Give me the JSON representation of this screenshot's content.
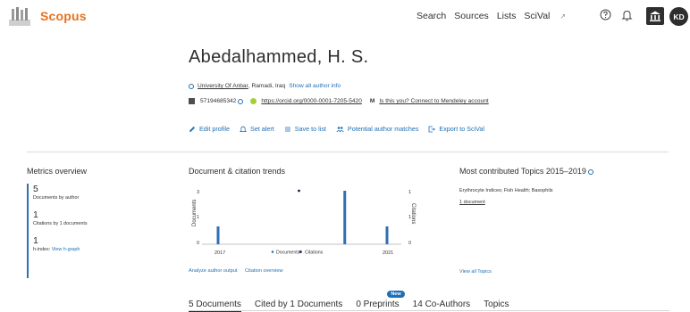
{
  "header": {
    "brand": "Scopus",
    "nav": [
      "Search",
      "Sources",
      "Lists",
      "SciVal"
    ],
    "nav_external_glyph": "↗",
    "avatar_initials": "KD",
    "icons": [
      "help-icon",
      "bell-icon",
      "institution-icon"
    ]
  },
  "author": {
    "name": "Abedalhammed, H. S.",
    "affiliation_link": "University Of Anbar",
    "affiliation_location": ", Ramadi, Iraq",
    "show_all_info": "Show all author info",
    "scopus_id": "57194685342",
    "orcid": "https://orcid.org/0000-0001-7205-5420",
    "mendeley_icon": "M",
    "mendeley_text": "Is this you? Connect to Mendeley account"
  },
  "actions": [
    {
      "label": "Edit profile",
      "icon": "pencil-icon"
    },
    {
      "label": "Set alert",
      "icon": "bell-icon"
    },
    {
      "label": "Save to list",
      "icon": "list-icon"
    },
    {
      "label": "Potential author matches",
      "icon": "people-icon"
    },
    {
      "label": "Export to SciVal",
      "icon": "export-icon"
    }
  ],
  "metrics": {
    "title": "Metrics overview",
    "documents": {
      "value": "5",
      "label": "Documents by author"
    },
    "citations": {
      "value": "1",
      "label": "Citations by 1 documents"
    },
    "h_index": {
      "value": "1",
      "label": "h-index:",
      "link": "View h-graph"
    }
  },
  "trends": {
    "title": "Document & citation trends",
    "analyze_link": "Analyze author output",
    "citation_link": "Citation overview"
  },
  "topics": {
    "title": "Most contributed Topics 2015–2019",
    "topic_text": "Erythrocyte Indices; Fish Health; Basophils",
    "docs": "1 document",
    "view_all": "View all Topics"
  },
  "tabs": [
    {
      "label": "5 Documents",
      "active": true
    },
    {
      "label": "Cited by 1 Documents",
      "active": false
    },
    {
      "label": "0 Preprints",
      "active": false,
      "badge": "New"
    },
    {
      "label": "14 Co-Authors",
      "active": false
    },
    {
      "label": "Topics",
      "active": false
    }
  ],
  "chart_data": {
    "type": "bar",
    "x_tick_labels": [
      "2017",
      "2021"
    ],
    "ylabel": "Documents",
    "y2label": "Citations",
    "left_ticks": [
      "3",
      "1",
      "0"
    ],
    "right_ticks": [
      "1",
      "1",
      "0"
    ],
    "series": [
      {
        "name": "Documents",
        "color": "#2e6fb6",
        "points": [
          {
            "x": 2017,
            "y": 1
          },
          {
            "x": 2020,
            "y": 3
          },
          {
            "x": 2021,
            "y": 1
          }
        ]
      },
      {
        "name": "Citations",
        "color": "#1c1c4a",
        "points": [
          {
            "x": 2019,
            "y": 1
          }
        ]
      }
    ],
    "xlim": [
      2017,
      2021
    ],
    "ylim": [
      0,
      3
    ],
    "y2lim": [
      0,
      1
    ],
    "legend": "bottom-center"
  }
}
